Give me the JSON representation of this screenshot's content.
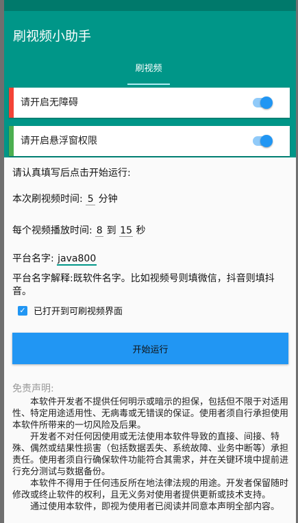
{
  "app": {
    "title": "刷视频小助手"
  },
  "tabs": [
    {
      "label": "刷视频"
    }
  ],
  "permissions": [
    {
      "label": "请开启无障碍",
      "color": "#f44336",
      "enabled": true
    },
    {
      "label": "请开启悬浮窗权限",
      "color": "#4caf50",
      "enabled": true
    }
  ],
  "form": {
    "intro": "请认真填写后点击开始运行:",
    "duration_label": "本次刷视频时间:",
    "duration_value": "5",
    "duration_unit": "分钟",
    "play_label": "每个视频播放时间:",
    "play_min": "8",
    "play_to": "到",
    "play_max": "15",
    "play_unit": "秒",
    "platform_label": "平台名字:",
    "platform_value": "java800",
    "platform_hint": "平台名字解释:既软件名字。比如视频号则填微信，抖音则填抖音。",
    "checkbox_label": "已打开到可刷视频界面",
    "checkbox_checked": true,
    "start_button": "开始运行"
  },
  "disclaimer": {
    "title": "免责声明:",
    "paragraphs": [
      "本软件开发者不提供任何明示或暗示的担保，包括但不限于对适用性、特定用途适用性、无病毒或无错误的保证。使用者须自行承担使用本软件所带来的一切风险及后果。",
      "开发者不对任何因使用或无法使用本软件导致的直接、间接、特殊、偶然或结果性损害（包括数据丢失、系统故障、业务中断等）承担责任。使用者须自行确保软件功能符合其需求，并在关键环境中提前进行充分测试与数据备份。",
      "本软件不得用于任何违反所在地法律法规的用途。开发者保留随时修改或终止软件的权利，且无义务对使用者提供更新或技术支持。",
      "通过使用本软件，即视为使用者已阅读并同意本声明全部内容。"
    ]
  },
  "colors": {
    "primary": "#009688",
    "status_bar": "#00796b",
    "accent": "#2196f3"
  }
}
